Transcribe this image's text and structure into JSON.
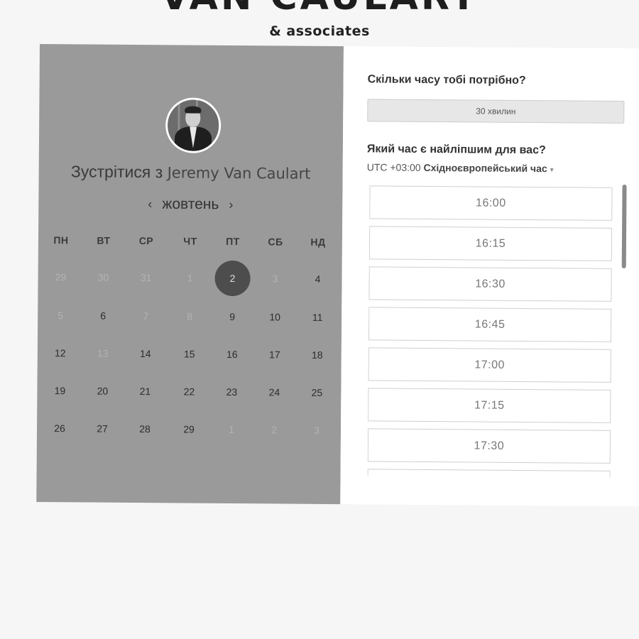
{
  "brand": {
    "name": "VAN CAULART",
    "tagline": "& associates"
  },
  "calendar": {
    "meet_prefix": "Зустрітися з ",
    "meet_name": "Jeremy Van Caulart",
    "month": "жовтень",
    "prev_icon": "‹",
    "next_icon": "›",
    "weekdays": [
      "ПН",
      "ВТ",
      "СР",
      "ЧТ",
      "ПТ",
      "СБ",
      "НД"
    ],
    "weeks": [
      [
        {
          "d": "29",
          "s": "out"
        },
        {
          "d": "30",
          "s": "out"
        },
        {
          "d": "31",
          "s": "out"
        },
        {
          "d": "1",
          "s": "dis"
        },
        {
          "d": "2",
          "s": "sel"
        },
        {
          "d": "3",
          "s": "dis"
        },
        {
          "d": "4",
          "s": "av"
        }
      ],
      [
        {
          "d": "5",
          "s": "dis"
        },
        {
          "d": "6",
          "s": "av"
        },
        {
          "d": "7",
          "s": "dis"
        },
        {
          "d": "8",
          "s": "dis"
        },
        {
          "d": "9",
          "s": "av"
        },
        {
          "d": "10",
          "s": "av"
        },
        {
          "d": "11",
          "s": "av"
        }
      ],
      [
        {
          "d": "12",
          "s": "av"
        },
        {
          "d": "13",
          "s": "dis"
        },
        {
          "d": "14",
          "s": "av"
        },
        {
          "d": "15",
          "s": "av"
        },
        {
          "d": "16",
          "s": "av"
        },
        {
          "d": "17",
          "s": "av"
        },
        {
          "d": "18",
          "s": "av"
        }
      ],
      [
        {
          "d": "19",
          "s": "av"
        },
        {
          "d": "20",
          "s": "av"
        },
        {
          "d": "21",
          "s": "av"
        },
        {
          "d": "22",
          "s": "av"
        },
        {
          "d": "23",
          "s": "av"
        },
        {
          "d": "24",
          "s": "av"
        },
        {
          "d": "25",
          "s": "av"
        }
      ],
      [
        {
          "d": "26",
          "s": "av"
        },
        {
          "d": "27",
          "s": "av"
        },
        {
          "d": "28",
          "s": "av"
        },
        {
          "d": "29",
          "s": "av"
        },
        {
          "d": "1",
          "s": "out"
        },
        {
          "d": "2",
          "s": "out"
        },
        {
          "d": "3",
          "s": "out"
        }
      ]
    ]
  },
  "booking": {
    "duration_question": "Скільки часу тобі потрібно?",
    "duration_value": "30 хвилин",
    "time_question": "Який час є найліпшим для вас?",
    "timezone_offset": "UTC +03:00",
    "timezone_name": "Східноєвропейський час",
    "timezone_caret": "▾",
    "slots": [
      "16:00",
      "16:15",
      "16:30",
      "16:45",
      "17:00",
      "17:15",
      "17:30",
      ""
    ]
  },
  "colors": {
    "calendar_bg": "#9a9a9a",
    "selected_day": "#4d4d4d",
    "panel_bg": "#ffffff"
  }
}
